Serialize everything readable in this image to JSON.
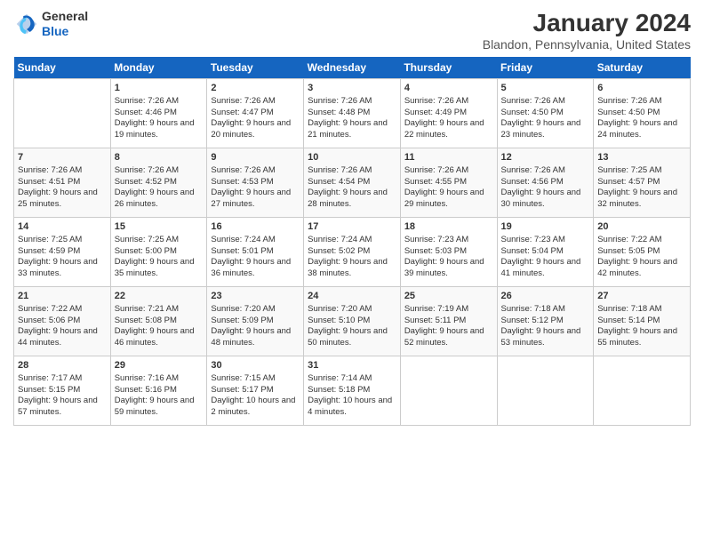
{
  "header": {
    "logo": {
      "general": "General",
      "blue": "Blue"
    },
    "title": "January 2024",
    "subtitle": "Blandon, Pennsylvania, United States"
  },
  "days_header": [
    "Sunday",
    "Monday",
    "Tuesday",
    "Wednesday",
    "Thursday",
    "Friday",
    "Saturday"
  ],
  "weeks": [
    [
      {
        "day": "",
        "sunrise": "",
        "sunset": "",
        "daylight": ""
      },
      {
        "day": "1",
        "sunrise": "Sunrise: 7:26 AM",
        "sunset": "Sunset: 4:46 PM",
        "daylight": "Daylight: 9 hours and 19 minutes."
      },
      {
        "day": "2",
        "sunrise": "Sunrise: 7:26 AM",
        "sunset": "Sunset: 4:47 PM",
        "daylight": "Daylight: 9 hours and 20 minutes."
      },
      {
        "day": "3",
        "sunrise": "Sunrise: 7:26 AM",
        "sunset": "Sunset: 4:48 PM",
        "daylight": "Daylight: 9 hours and 21 minutes."
      },
      {
        "day": "4",
        "sunrise": "Sunrise: 7:26 AM",
        "sunset": "Sunset: 4:49 PM",
        "daylight": "Daylight: 9 hours and 22 minutes."
      },
      {
        "day": "5",
        "sunrise": "Sunrise: 7:26 AM",
        "sunset": "Sunset: 4:50 PM",
        "daylight": "Daylight: 9 hours and 23 minutes."
      },
      {
        "day": "6",
        "sunrise": "Sunrise: 7:26 AM",
        "sunset": "Sunset: 4:50 PM",
        "daylight": "Daylight: 9 hours and 24 minutes."
      }
    ],
    [
      {
        "day": "7",
        "sunrise": "Sunrise: 7:26 AM",
        "sunset": "Sunset: 4:51 PM",
        "daylight": "Daylight: 9 hours and 25 minutes."
      },
      {
        "day": "8",
        "sunrise": "Sunrise: 7:26 AM",
        "sunset": "Sunset: 4:52 PM",
        "daylight": "Daylight: 9 hours and 26 minutes."
      },
      {
        "day": "9",
        "sunrise": "Sunrise: 7:26 AM",
        "sunset": "Sunset: 4:53 PM",
        "daylight": "Daylight: 9 hours and 27 minutes."
      },
      {
        "day": "10",
        "sunrise": "Sunrise: 7:26 AM",
        "sunset": "Sunset: 4:54 PM",
        "daylight": "Daylight: 9 hours and 28 minutes."
      },
      {
        "day": "11",
        "sunrise": "Sunrise: 7:26 AM",
        "sunset": "Sunset: 4:55 PM",
        "daylight": "Daylight: 9 hours and 29 minutes."
      },
      {
        "day": "12",
        "sunrise": "Sunrise: 7:26 AM",
        "sunset": "Sunset: 4:56 PM",
        "daylight": "Daylight: 9 hours and 30 minutes."
      },
      {
        "day": "13",
        "sunrise": "Sunrise: 7:25 AM",
        "sunset": "Sunset: 4:57 PM",
        "daylight": "Daylight: 9 hours and 32 minutes."
      }
    ],
    [
      {
        "day": "14",
        "sunrise": "Sunrise: 7:25 AM",
        "sunset": "Sunset: 4:59 PM",
        "daylight": "Daylight: 9 hours and 33 minutes."
      },
      {
        "day": "15",
        "sunrise": "Sunrise: 7:25 AM",
        "sunset": "Sunset: 5:00 PM",
        "daylight": "Daylight: 9 hours and 35 minutes."
      },
      {
        "day": "16",
        "sunrise": "Sunrise: 7:24 AM",
        "sunset": "Sunset: 5:01 PM",
        "daylight": "Daylight: 9 hours and 36 minutes."
      },
      {
        "day": "17",
        "sunrise": "Sunrise: 7:24 AM",
        "sunset": "Sunset: 5:02 PM",
        "daylight": "Daylight: 9 hours and 38 minutes."
      },
      {
        "day": "18",
        "sunrise": "Sunrise: 7:23 AM",
        "sunset": "Sunset: 5:03 PM",
        "daylight": "Daylight: 9 hours and 39 minutes."
      },
      {
        "day": "19",
        "sunrise": "Sunrise: 7:23 AM",
        "sunset": "Sunset: 5:04 PM",
        "daylight": "Daylight: 9 hours and 41 minutes."
      },
      {
        "day": "20",
        "sunrise": "Sunrise: 7:22 AM",
        "sunset": "Sunset: 5:05 PM",
        "daylight": "Daylight: 9 hours and 42 minutes."
      }
    ],
    [
      {
        "day": "21",
        "sunrise": "Sunrise: 7:22 AM",
        "sunset": "Sunset: 5:06 PM",
        "daylight": "Daylight: 9 hours and 44 minutes."
      },
      {
        "day": "22",
        "sunrise": "Sunrise: 7:21 AM",
        "sunset": "Sunset: 5:08 PM",
        "daylight": "Daylight: 9 hours and 46 minutes."
      },
      {
        "day": "23",
        "sunrise": "Sunrise: 7:20 AM",
        "sunset": "Sunset: 5:09 PM",
        "daylight": "Daylight: 9 hours and 48 minutes."
      },
      {
        "day": "24",
        "sunrise": "Sunrise: 7:20 AM",
        "sunset": "Sunset: 5:10 PM",
        "daylight": "Daylight: 9 hours and 50 minutes."
      },
      {
        "day": "25",
        "sunrise": "Sunrise: 7:19 AM",
        "sunset": "Sunset: 5:11 PM",
        "daylight": "Daylight: 9 hours and 52 minutes."
      },
      {
        "day": "26",
        "sunrise": "Sunrise: 7:18 AM",
        "sunset": "Sunset: 5:12 PM",
        "daylight": "Daylight: 9 hours and 53 minutes."
      },
      {
        "day": "27",
        "sunrise": "Sunrise: 7:18 AM",
        "sunset": "Sunset: 5:14 PM",
        "daylight": "Daylight: 9 hours and 55 minutes."
      }
    ],
    [
      {
        "day": "28",
        "sunrise": "Sunrise: 7:17 AM",
        "sunset": "Sunset: 5:15 PM",
        "daylight": "Daylight: 9 hours and 57 minutes."
      },
      {
        "day": "29",
        "sunrise": "Sunrise: 7:16 AM",
        "sunset": "Sunset: 5:16 PM",
        "daylight": "Daylight: 9 hours and 59 minutes."
      },
      {
        "day": "30",
        "sunrise": "Sunrise: 7:15 AM",
        "sunset": "Sunset: 5:17 PM",
        "daylight": "Daylight: 10 hours and 2 minutes."
      },
      {
        "day": "31",
        "sunrise": "Sunrise: 7:14 AM",
        "sunset": "Sunset: 5:18 PM",
        "daylight": "Daylight: 10 hours and 4 minutes."
      },
      {
        "day": "",
        "sunrise": "",
        "sunset": "",
        "daylight": ""
      },
      {
        "day": "",
        "sunrise": "",
        "sunset": "",
        "daylight": ""
      },
      {
        "day": "",
        "sunrise": "",
        "sunset": "",
        "daylight": ""
      }
    ]
  ]
}
